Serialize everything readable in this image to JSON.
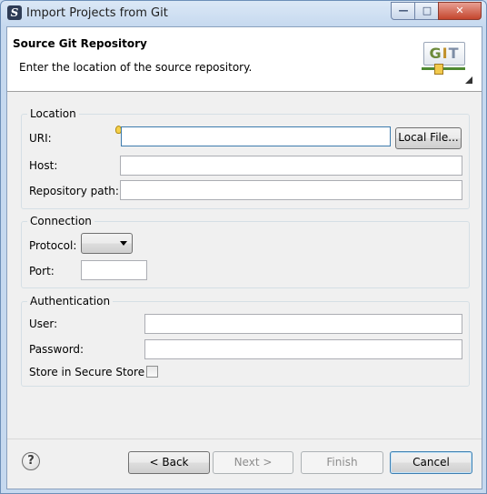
{
  "window": {
    "title": "Import Projects from Git",
    "controls": {
      "minimize": "—",
      "maximize": "□",
      "close": "✕"
    }
  },
  "header": {
    "title": "Source Git Repository",
    "description": "Enter the location of the source repository.",
    "logo_text": [
      "G",
      "I",
      "T"
    ]
  },
  "location": {
    "group_title": "Location",
    "uri_label": "URI:",
    "uri_value": "",
    "local_file_button": "Local File...",
    "host_label": "Host:",
    "host_value": "",
    "repo_path_label": "Repository path:",
    "repo_path_value": ""
  },
  "connection": {
    "group_title": "Connection",
    "protocol_label": "Protocol:",
    "protocol_value": "",
    "port_label": "Port:",
    "port_value": ""
  },
  "authentication": {
    "group_title": "Authentication",
    "user_label": "User:",
    "user_value": "",
    "password_label": "Password:",
    "password_value": "",
    "secure_store_label": "Store in Secure Store",
    "secure_store_checked": false
  },
  "footer": {
    "help": "?",
    "back": "< Back",
    "next": "Next >",
    "finish": "Finish",
    "cancel": "Cancel"
  }
}
